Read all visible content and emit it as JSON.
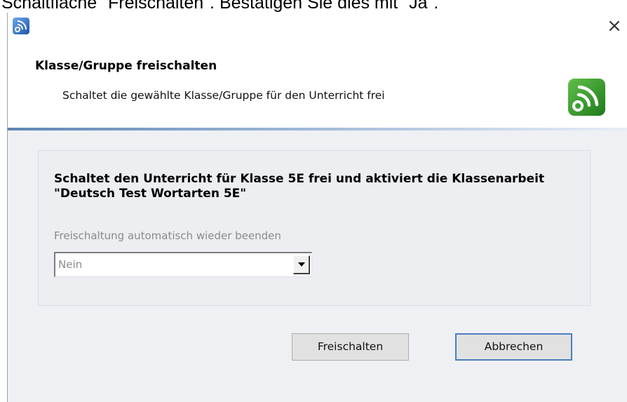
{
  "caption": "Schaltfläche \"Freischalten\". Bestätigen Sie dies mit \"Ja\".",
  "window": {
    "close_glyph": "×",
    "app_icon": "wireless-signal-icon"
  },
  "header": {
    "title": "Klasse/Gruppe freischalten",
    "subtitle": "Schaltet die gewählte Klasse/Gruppe für den Unterricht frei",
    "logo_icon": "wireless-signal-logo-icon",
    "logo_color": "#3a9a2a"
  },
  "content": {
    "message": "Schaltet den Unterricht für Klasse 5E frei und aktiviert die Klassenarbeit \"Deutsch Test Wortarten 5E\"",
    "auto_end_label": "Freischaltung automatisch wieder beenden",
    "auto_end_value": "Nein"
  },
  "buttons": {
    "confirm_label": "Freischalten",
    "cancel_label": "Abbrechen"
  },
  "colors": {
    "divider_accent": "#5f86b4",
    "focus_border": "#4a7fc0",
    "body_bg": "#eef0f4"
  }
}
